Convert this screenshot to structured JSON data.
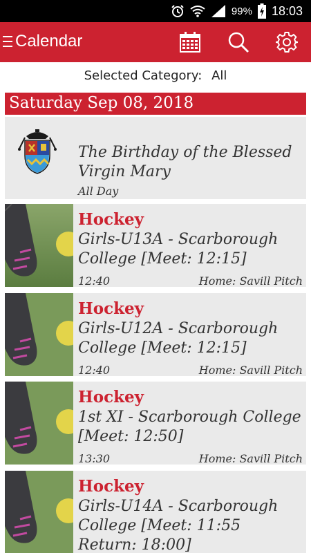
{
  "status_bar": {
    "battery_pct": "99%",
    "time": "18:03"
  },
  "app_bar": {
    "title": "Calendar",
    "menu_icon": "menu-icon",
    "actions": [
      "calendar-icon",
      "search-icon",
      "gear-icon"
    ]
  },
  "category": {
    "label": "Selected Category:",
    "value": "All"
  },
  "date_header": "Saturday Sep 08, 2018",
  "colors": {
    "accent": "#cc2230",
    "card_bg": "#eaeaea"
  },
  "feast": {
    "title": "The Birthday of the Blessed Virgin Mary",
    "time": "All Day",
    "icon": "school-crest-icon"
  },
  "events": [
    {
      "category": "Hockey",
      "title": "Girls-U13A - Scarborough College [Meet: 12:15]",
      "time": "12:40",
      "location": "Home: Savill Pitch"
    },
    {
      "category": "Hockey",
      "title": "Girls-U12A - Scarborough College [Meet: 12:15]",
      "time": "12:40",
      "location": "Home: Savill Pitch"
    },
    {
      "category": "Hockey",
      "title": "1st XI - Scarborough College [Meet: 12:50]",
      "time": "13:30",
      "location": "Home: Savill Pitch"
    },
    {
      "category": "Hockey",
      "title": "Girls-U14A - Scarborough College [Meet: 11:55 Return: 18:00]",
      "time": "",
      "location": ""
    }
  ]
}
